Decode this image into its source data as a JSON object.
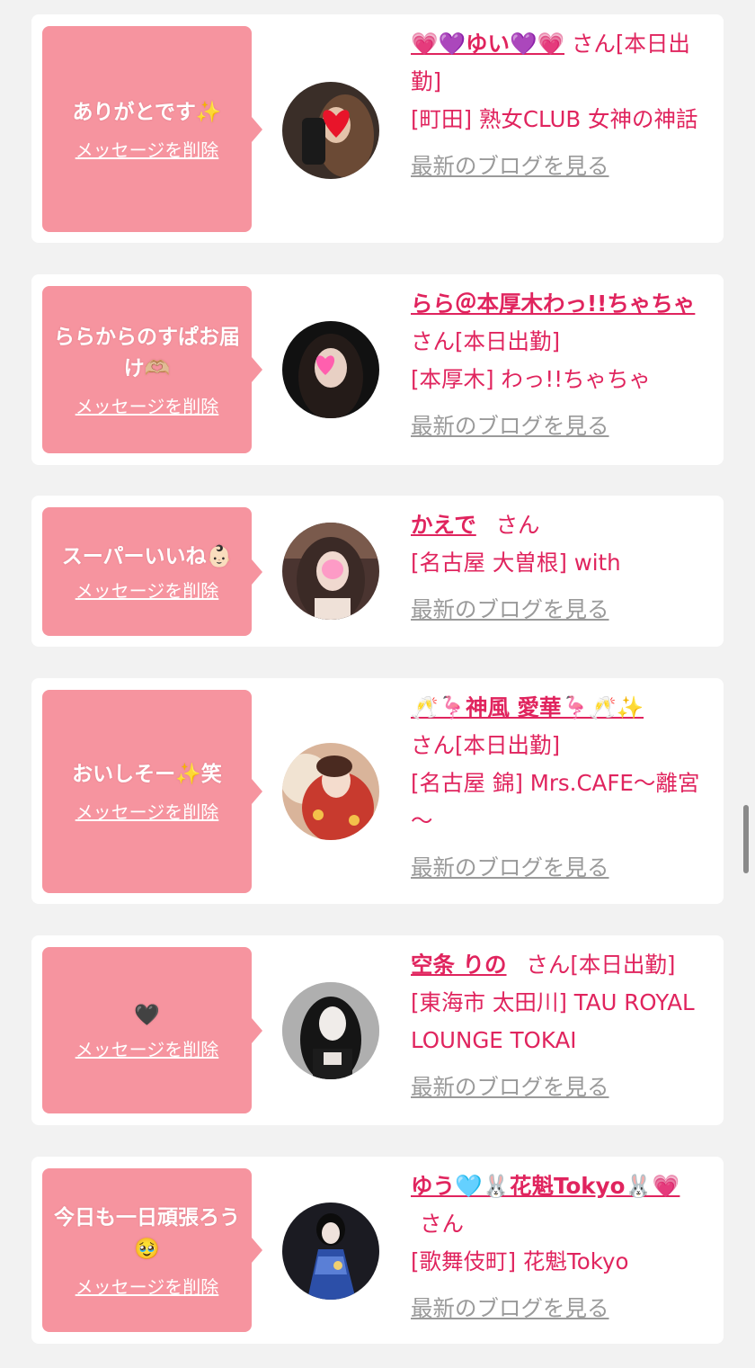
{
  "colors": {
    "accent": "#e0245e",
    "bubble": "#f6949f",
    "link_gray": "#9a9a9a",
    "page_bg": "#f2f2f2"
  },
  "delete_label": "メッセージを削除",
  "blog_label": "最新のブログを見る",
  "san_label": "さん",
  "cards": [
    {
      "message": "ありがとです✨",
      "name": "💗💜ゆい💜💗",
      "suffix": "さん[本日出勤]",
      "shop": "[町田] 熟女CLUB 女神の神話"
    },
    {
      "message": "ららからのすぱお届け🫶🏼",
      "name": "らら＠本厚木わっ!!ちゃちゃ",
      "suffix": "さん[本日出勤]",
      "shop": "[本厚木] わっ!!ちゃちゃ"
    },
    {
      "message": "スーパーいいね👶🏻",
      "name": "かえで",
      "suffix": "さん",
      "shop": "[名古屋 大曽根] with"
    },
    {
      "message": "おいしそー✨笑",
      "name": "🥂🦩神風 愛華🦩🥂✨",
      "suffix": "さん[本日出勤]",
      "shop": "[名古屋 錦] Mrs.CAFE～離宮～"
    },
    {
      "message": "🖤",
      "name": "空条 りの",
      "suffix": "さん[本日出勤]",
      "shop": "[東海市 太田川] TAU ROYAL LOUNGE TOKAI"
    },
    {
      "message": "今日も一日頑張ろう🥹",
      "name": "ゆう🩵🐰花魁Tokyo🐰💗",
      "suffix": "さん",
      "shop": "[歌舞伎町] 花魁Tokyo"
    }
  ]
}
